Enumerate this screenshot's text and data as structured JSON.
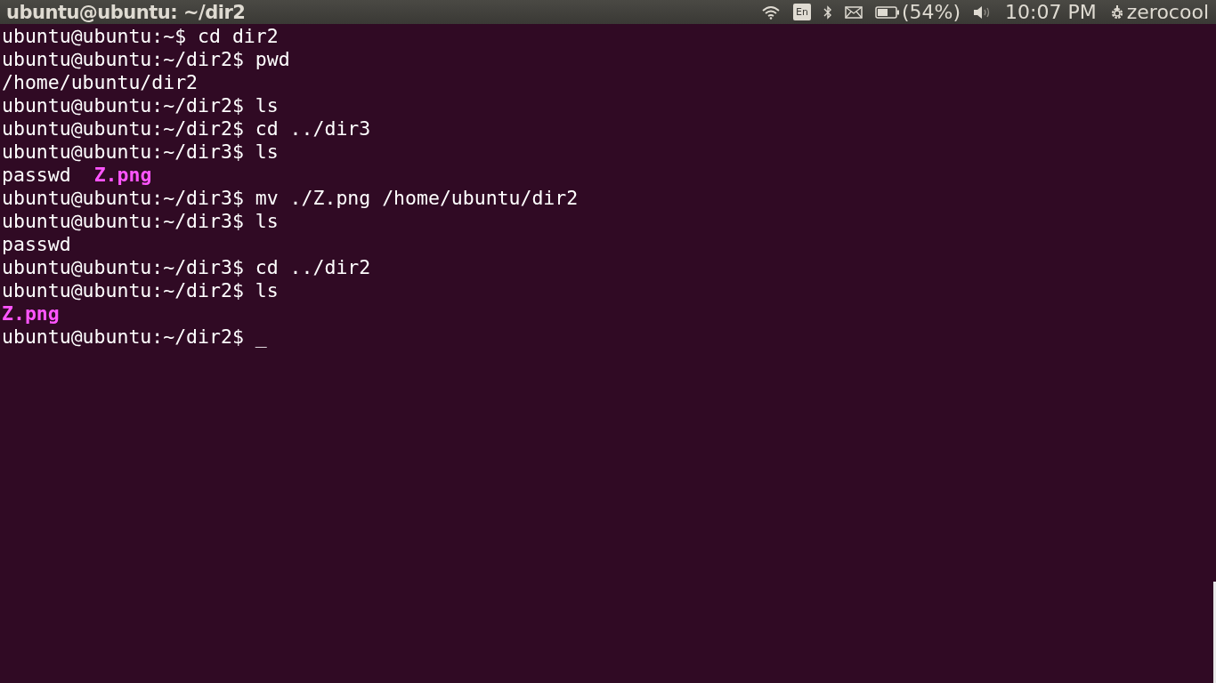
{
  "top_bar": {
    "window_title": "ubuntu@ubuntu: ~/dir2",
    "keyboard_layout": "En",
    "battery_percent": "(54%)",
    "time": "10:07 PM",
    "user": "zerocool"
  },
  "terminal": {
    "lines": [
      {
        "segments": [
          {
            "text": "ubuntu@ubuntu:~$ cd dir2",
            "kind": "plain"
          }
        ]
      },
      {
        "segments": [
          {
            "text": "ubuntu@ubuntu:~/dir2$ pwd",
            "kind": "plain"
          }
        ]
      },
      {
        "segments": [
          {
            "text": "/home/ubuntu/dir2",
            "kind": "plain"
          }
        ]
      },
      {
        "segments": [
          {
            "text": "ubuntu@ubuntu:~/dir2$ ls",
            "kind": "plain"
          }
        ]
      },
      {
        "segments": [
          {
            "text": "ubuntu@ubuntu:~/dir2$ cd ../dir3",
            "kind": "plain"
          }
        ]
      },
      {
        "segments": [
          {
            "text": "ubuntu@ubuntu:~/dir3$ ls",
            "kind": "plain"
          }
        ]
      },
      {
        "segments": [
          {
            "text": "passwd",
            "kind": "plain"
          },
          {
            "text": "Z.png",
            "kind": "image_file"
          }
        ]
      },
      {
        "segments": [
          {
            "text": "ubuntu@ubuntu:~/dir3$ mv ./Z.png /home/ubuntu/dir2",
            "kind": "plain"
          }
        ]
      },
      {
        "segments": [
          {
            "text": "ubuntu@ubuntu:~/dir3$ ls",
            "kind": "plain"
          }
        ]
      },
      {
        "segments": [
          {
            "text": "passwd",
            "kind": "plain"
          }
        ]
      },
      {
        "segments": [
          {
            "text": "ubuntu@ubuntu:~/dir3$ cd ../dir2",
            "kind": "plain"
          }
        ]
      },
      {
        "segments": [
          {
            "text": "ubuntu@ubuntu:~/dir2$ ls",
            "kind": "plain"
          }
        ]
      },
      {
        "segments": [
          {
            "text": "Z.png",
            "kind": "image_file"
          }
        ]
      },
      {
        "segments": [
          {
            "text": "ubuntu@ubuntu:~/dir2$",
            "kind": "plain"
          },
          {
            "text": "_",
            "kind": "cursor"
          }
        ]
      }
    ]
  }
}
